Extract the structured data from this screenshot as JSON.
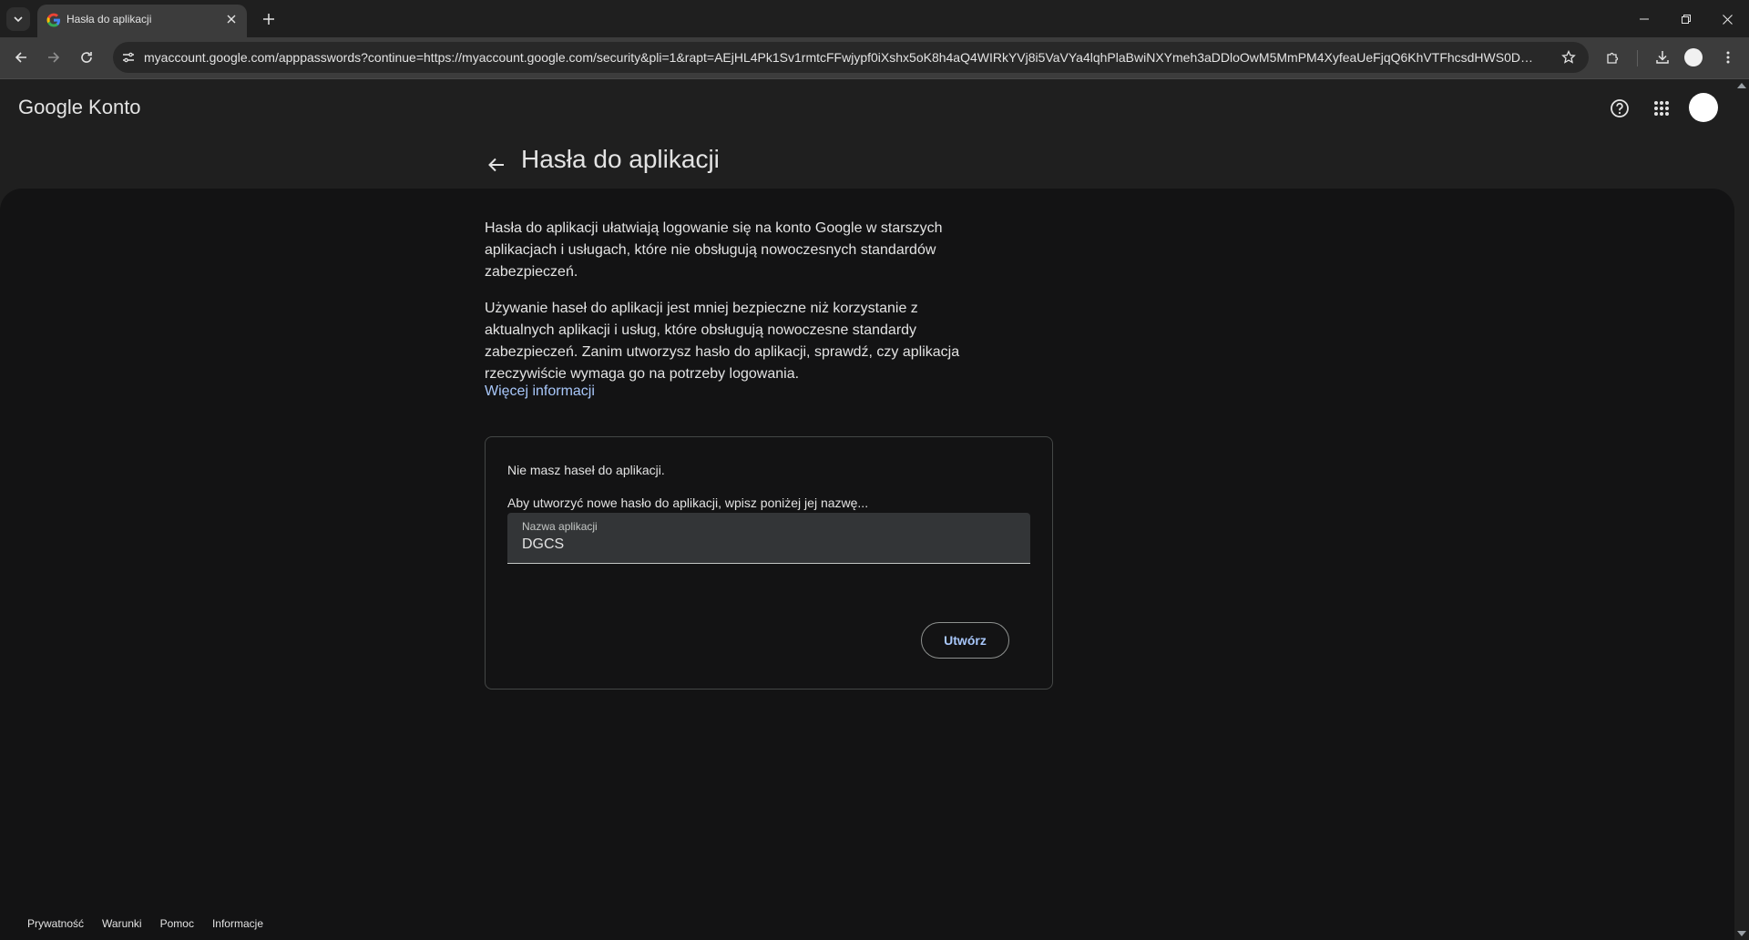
{
  "browser": {
    "tab": {
      "title": "Hasła do aplikacji"
    },
    "url": "myaccount.google.com/apppasswords?continue=https://myaccount.google.com/security&pli=1&rapt=AEjHL4Pk1Sv1rmtcFFwjypf0iXshx5oK8h4aQ4WIRkYVj8i5VaVYa4lqhPlaBwiNXYmeh3aDDloOwM5MmPM4XyfeaUeFjqQ6KhVTFhcsdHWS0DATTTOc..."
  },
  "header": {
    "brand": "Google Konto"
  },
  "page": {
    "title": "Hasła do aplikacji",
    "paragraph1": "Hasła do aplikacji ułatwiają logowanie się na konto Google w starszych aplikacjach i usługach, które nie obsługują nowoczesnych standardów zabezpieczeń.",
    "paragraph2": "Używanie haseł do aplikacji jest mniej bezpieczne niż korzystanie z aktualnych aplikacji i usług, które obsługują nowoczesne standardy zabezpieczeń. Zanim utworzysz hasło do aplikacji, sprawdź, czy aplikacja rzeczywiście wymaga go na potrzeby logowania.",
    "more_link": "Więcej informacji"
  },
  "card": {
    "empty_text": "Nie masz haseł do aplikacji.",
    "hint": "Aby utworzyć nowe hasło do aplikacji, wpisz poniżej jej nazwę...",
    "field_label": "Nazwa aplikacji",
    "field_value": "DGCS",
    "create_label": "Utwórz"
  },
  "footer": {
    "privacy": "Prywatność",
    "terms": "Warunki",
    "help": "Pomoc",
    "about": "Informacje"
  },
  "colors": {
    "background": "#131314",
    "link": "#a8c7fa"
  }
}
